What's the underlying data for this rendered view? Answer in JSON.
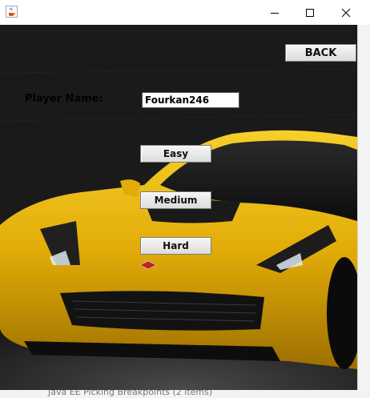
{
  "window": {
    "icon": "java-cup-icon",
    "controls": [
      "minimize-icon",
      "maximize-icon",
      "close-icon"
    ]
  },
  "form": {
    "back_label": "BACK",
    "player_name_label": "Player Name:",
    "player_name_value": "Fourkan246",
    "difficulty_buttons": [
      "Easy",
      "Medium",
      "Hard"
    ]
  },
  "background": {
    "subject": "yellow-sports-car",
    "accent_color": "#e8b10c"
  },
  "underlying": {
    "bottom_text": "Java EE Picking Breakpoints (2 items)"
  }
}
